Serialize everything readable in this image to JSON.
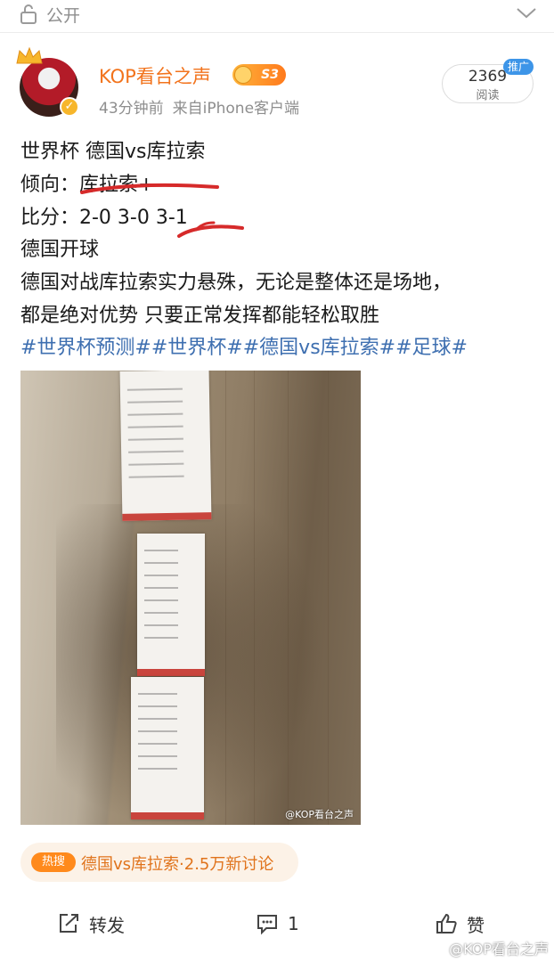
{
  "topbar": {
    "visibility_label": "公开"
  },
  "author": {
    "name": "KOP看台之声",
    "level": "S3",
    "time": "43分钟前",
    "source": "来自iPhone客户端"
  },
  "stats": {
    "read_count": "2369",
    "read_label": "阅读",
    "promo_tag": "推广"
  },
  "post": {
    "lines": [
      "世界杯 德国vs库拉索",
      "倾向：库拉索+",
      "比分：2-0 3-0 3-1",
      "德国开球",
      "德国对战库拉索实力悬殊，无论是整体还是场地，",
      "都是绝对优势 只要正常发挥都能轻松取胜"
    ],
    "hashtags": "#世界杯预测##世界杯##德国vs库拉索##足球#"
  },
  "image": {
    "watermark": "@KOP看台之声"
  },
  "hot": {
    "tag": "热搜",
    "text": "德国vs库拉索·2.5万新讨论"
  },
  "actions": {
    "share_label": "转发",
    "comment_count": "1",
    "like_label": "赞"
  },
  "footer_watermark": "@KOP看台之声"
}
